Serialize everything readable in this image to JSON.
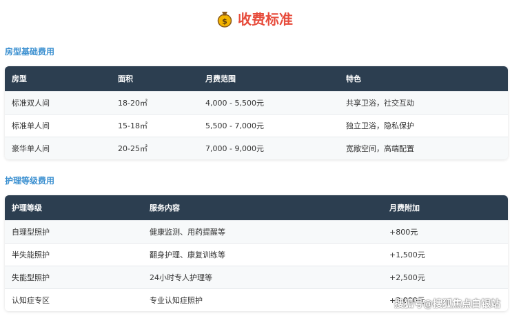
{
  "header": {
    "title": "收费标准",
    "icon": "money-bag-icon"
  },
  "room_section": {
    "title": "房型基础费用",
    "columns": [
      "房型",
      "面积",
      "月费范围",
      "特色"
    ],
    "rows": [
      [
        "标准双人间",
        "18-20㎡",
        "4,000 - 5,500元",
        "共享卫浴，社交互动"
      ],
      [
        "标准单人间",
        "15-18㎡",
        "5,500 - 7,000元",
        "独立卫浴，隐私保护"
      ],
      [
        "豪华单人间",
        "20-25㎡",
        "7,000 - 9,000元",
        "宽敞空间，高端配置"
      ]
    ]
  },
  "care_section": {
    "title": "护理等级费用",
    "columns": [
      "护理等级",
      "服务内容",
      "月费附加"
    ],
    "rows": [
      [
        "自理型照护",
        "健康监测、用药提醒等",
        "+800元"
      ],
      [
        "半失能照护",
        "翻身护理、康复训练等",
        "+1,500元"
      ],
      [
        "失能型照护",
        "24小时专人护理等",
        "+2,500元"
      ],
      [
        "认知症专区",
        "专业认知症照护",
        "+3,000元"
      ]
    ]
  },
  "watermark": "搜狐号@搜狐焦点白银站",
  "colors": {
    "title": "#e74c3c",
    "section_title": "#3a8fd0",
    "table_header": "#2c3e50"
  }
}
